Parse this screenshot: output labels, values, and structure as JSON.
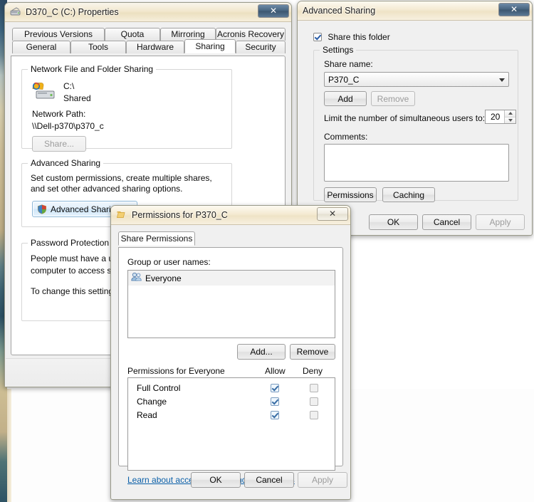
{
  "desktop": {
    "background_color": "#ffffff",
    "wallpaper_strip_colors": [
      "#2e4a63",
      "#c8b88f",
      "#3c6272",
      "#cdbd93"
    ]
  },
  "properties_window": {
    "title": "D370_C (C:) Properties",
    "title_icon": "drive-icon",
    "close_label": "✕",
    "tabs_row1": [
      {
        "label": "Previous Versions",
        "selected": false
      },
      {
        "label": "Quota",
        "selected": false
      },
      {
        "label": "Mirroring",
        "selected": false
      },
      {
        "label": "Acronis Recovery",
        "selected": false
      }
    ],
    "tabs_row2": [
      {
        "label": "General",
        "selected": false
      },
      {
        "label": "Tools",
        "selected": false
      },
      {
        "label": "Hardware",
        "selected": false
      },
      {
        "label": "Sharing",
        "selected": true
      },
      {
        "label": "Security",
        "selected": false
      }
    ],
    "network_sharing": {
      "group_title": "Network File and Folder Sharing",
      "folder_icon": "shared-folder-icon",
      "folder_name": "C:\\",
      "folder_state": "Shared",
      "network_path_label": "Network Path:",
      "network_path_value": "\\\\Dell-p370\\p370_c",
      "share_button": "Share...",
      "share_button_enabled": false
    },
    "advanced_sharing": {
      "group_title": "Advanced Sharing",
      "description": "Set custom permissions, create multiple shares, and set other advanced sharing options.",
      "button_label": "Advanced Sharing...",
      "button_icon": "uac-shield-icon"
    },
    "password_protection": {
      "group_title": "Password Protection",
      "line1": "People must have a user ac",
      "line2": "computer to access shared",
      "line3": "To change this setting, use"
    }
  },
  "advanced_sharing_window": {
    "title": "Advanced Sharing",
    "close_label": "✕",
    "share_this_folder": {
      "label": "Share this folder",
      "checked": true
    },
    "settings_group_title": "Settings",
    "share_name_label": "Share name:",
    "share_name_value": "P370_C",
    "add_button": "Add",
    "remove_button": "Remove",
    "remove_enabled": false,
    "limit_label": "Limit the number of simultaneous users to:",
    "limit_value": "20",
    "comments_label": "Comments:",
    "comments_value": "",
    "permissions_button": "Permissions",
    "caching_button": "Caching",
    "ok_button": "OK",
    "cancel_button": "Cancel",
    "apply_button": "Apply",
    "apply_enabled": false
  },
  "permissions_window": {
    "title": "Permissions for P370_C",
    "title_icon": "folder-permissions-icon",
    "close_label": "✕",
    "tab_label": "Share Permissions",
    "group_names_label": "Group or user names:",
    "group_entries": [
      {
        "name": "Everyone",
        "icon": "users-group-icon"
      }
    ],
    "add_button": "Add...",
    "remove_button": "Remove",
    "perms_for_label": "Permissions for Everyone",
    "allow_header": "Allow",
    "deny_header": "Deny",
    "permissions": [
      {
        "name": "Full Control",
        "allow": true,
        "deny": false
      },
      {
        "name": "Change",
        "allow": true,
        "deny": false
      },
      {
        "name": "Read",
        "allow": true,
        "deny": false
      }
    ],
    "learn_link": "Learn about access control and permissions",
    "ok_button": "OK",
    "cancel_button": "Cancel",
    "apply_button": "Apply",
    "apply_enabled": false
  }
}
